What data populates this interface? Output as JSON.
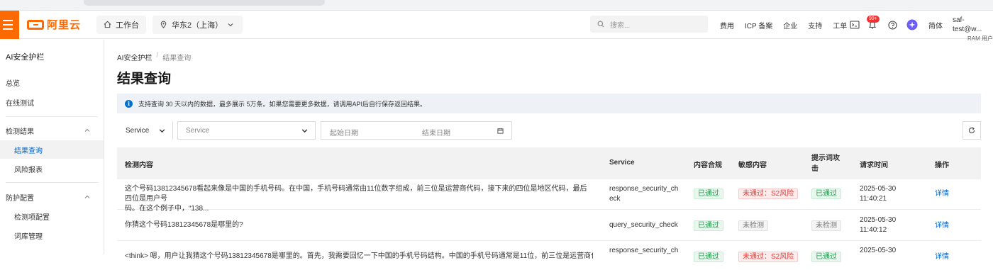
{
  "topbar": {
    "logo_text": "阿里云",
    "home_label": "工作台",
    "region_label": "华东2（上海）",
    "search_placeholder": "搜索...",
    "nav": [
      "费用",
      "ICP 备案",
      "企业",
      "支持",
      "工单"
    ],
    "notification_badge": "99+",
    "language": "简体",
    "account_name": "saf-test@w...",
    "account_role": "RAM 用户"
  },
  "sidebar": {
    "title": "AI安全护栏",
    "overview": "总览",
    "online_test": "在线测试",
    "group_results": "检测结果",
    "result_query": "结果查询",
    "risk_report": "风险报表",
    "group_protection": "防护配置",
    "detection_config": "检测项配置",
    "lexicon": "词库管理"
  },
  "breadcrumb": {
    "root": "AI安全护栏",
    "current": "结果查询"
  },
  "page_title": "结果查询",
  "notice": "支持查询 30 天以内的数据，最多展示 5万条。如果您需要更多数据，请调用API后自行保存返回结果。",
  "filters": {
    "field_select": "Service",
    "service_placeholder": "Service",
    "start_date": "起始日期",
    "end_date": "结束日期"
  },
  "table": {
    "columns": [
      "检测内容",
      "Service",
      "内容合规",
      "敏感内容",
      "提示词攻击",
      "请求时间",
      "操作"
    ],
    "rows": [
      {
        "content_1": "这个号码13812345678看起来像是中国的手机号码。在中国，手机号码通常由11位数字组成，前三位是运营商代码，接下来的四位是地区代码，最后四位是用户号",
        "content_2": "码。在这个例子中，“138...",
        "service_1": "response_security_ch",
        "service_2": "eck",
        "compliance": "已通过",
        "sensitive": "未通过：S2风险",
        "prompt_attack": "已通过",
        "date": "2025-05-30",
        "time": "11:40:21",
        "action": "详情"
      },
      {
        "content_1": "你猜这个号码13812345678是哪里的?",
        "content_2": "",
        "service_1": "query_security_check",
        "service_2": "",
        "compliance": "已通过",
        "sensitive": "未检测",
        "prompt_attack": "未检测",
        "date": "2025-05-30",
        "time": "11:40:12",
        "action": "详情"
      },
      {
        "content_1": "<think> 嗯，用户让我猜这个号码13812345678是哪里的。首先，我需要回忆一下中国的手机号码结构。中国的手机号码通常是11位，前三位是运营商代码，接下来",
        "content_2": "",
        "service_1": "response_security_ch",
        "service_2": "",
        "compliance": "已通过",
        "sensitive": "未通过：S2风险",
        "prompt_attack": "已通过",
        "date": "2025-05-30",
        "time": "",
        "action": "详情"
      }
    ]
  }
}
